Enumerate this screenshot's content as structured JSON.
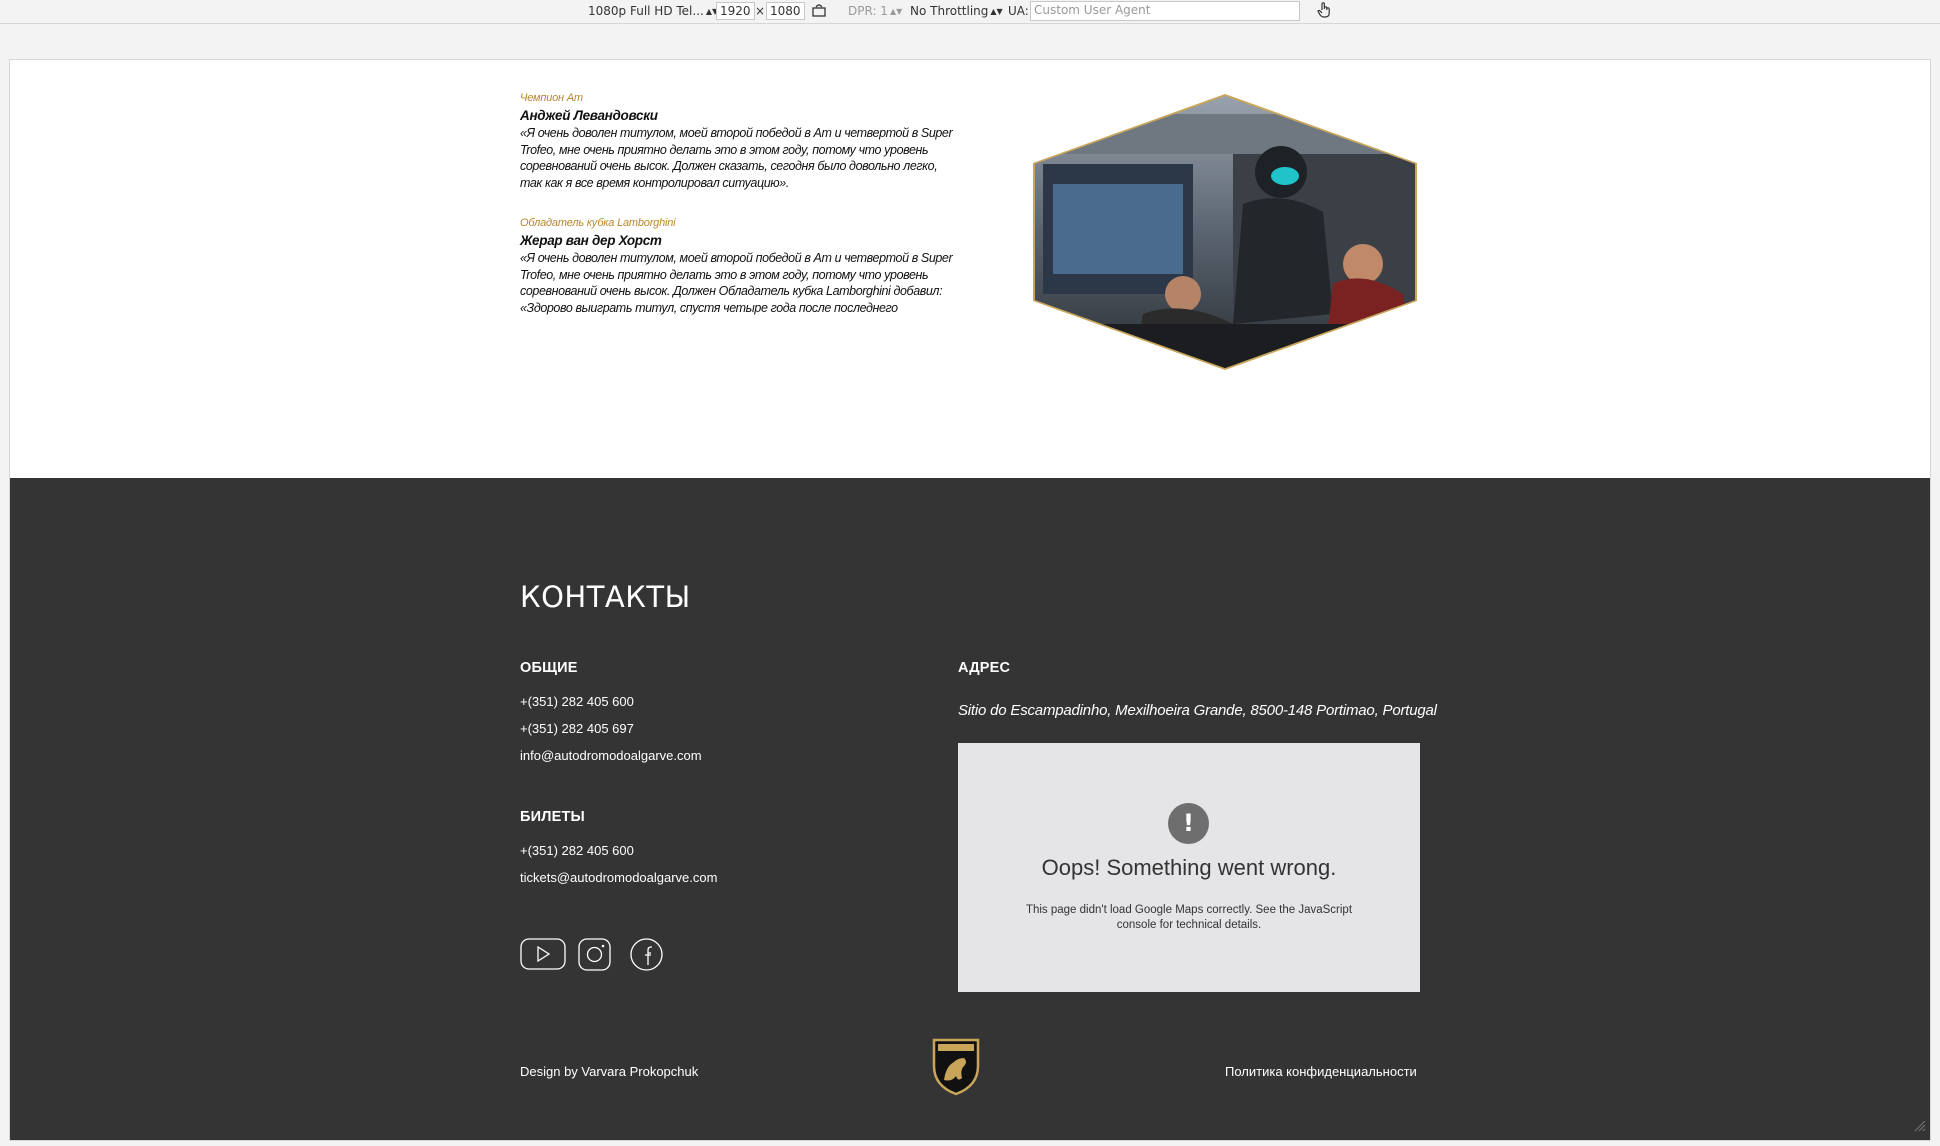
{
  "devtools": {
    "device": "1080p Full HD Tel...",
    "width": "1920",
    "times": "×",
    "height": "1080",
    "dpr": "DPR: 1",
    "throttling": "No Throttling",
    "ua_label": "UA:",
    "ua_placeholder": "Custom User Agent"
  },
  "quotes": [
    {
      "tag": "Чемпион Am",
      "name": "Анджей Левандовски",
      "text": "«Я очень доволен титулом, моей второй победой в Am и четвертой в Super Trofeo, мне очень приятно делать это в этом году, потому что уровень соревнований очень высок. Должен сказать, сегодня было довольно легко, так как я все время контролировал ситуацию»."
    },
    {
      "tag": "Обладатель кубка Lamborghini",
      "name": "Жерар ван дер Хорст",
      "text": "«Я очень доволен титулом, моей второй победой в Am и четвертой в Super Trofeo, мне очень приятно делать это в этом году, потому что уровень соревнований очень высок. Должен Обладатель кубка Lamborghini добавил: «Здорово выиграть титул, спустя четыре года после последнего"
    }
  ],
  "contacts": {
    "title": "КОНТАКТЫ",
    "general": {
      "heading": "ОБЩИЕ",
      "lines": [
        "+(351) 282 405 600",
        "+(351) 282 405 697",
        "info@autodromodoalgarve.com"
      ]
    },
    "tickets": {
      "heading": "БИЛЕТЫ",
      "lines": [
        "+(351) 282 405 600",
        "tickets@autodromodoalgarve.com"
      ]
    },
    "address": {
      "heading": "АДРЕС",
      "text": "Sitio do Escampadinho, Mexilhoeira Grande, 8500-148 Portimao, Portugal"
    },
    "map_error": {
      "icon": "!",
      "title": "Oops! Something went wrong.",
      "text": "This page didn't load Google Maps correctly. See the JavaScript console for technical details."
    },
    "social": [
      "youtube-icon",
      "instagram-icon",
      "facebook-icon"
    ]
  },
  "footer": {
    "credit": "Design by Varvara Prokopchuk",
    "privacy": "Политика конфиденциальности",
    "logo": "lamborghini-logo"
  },
  "colors": {
    "accent": "#b8862b",
    "footer_bg": "#343434",
    "map_bg": "#e5e5e8"
  }
}
